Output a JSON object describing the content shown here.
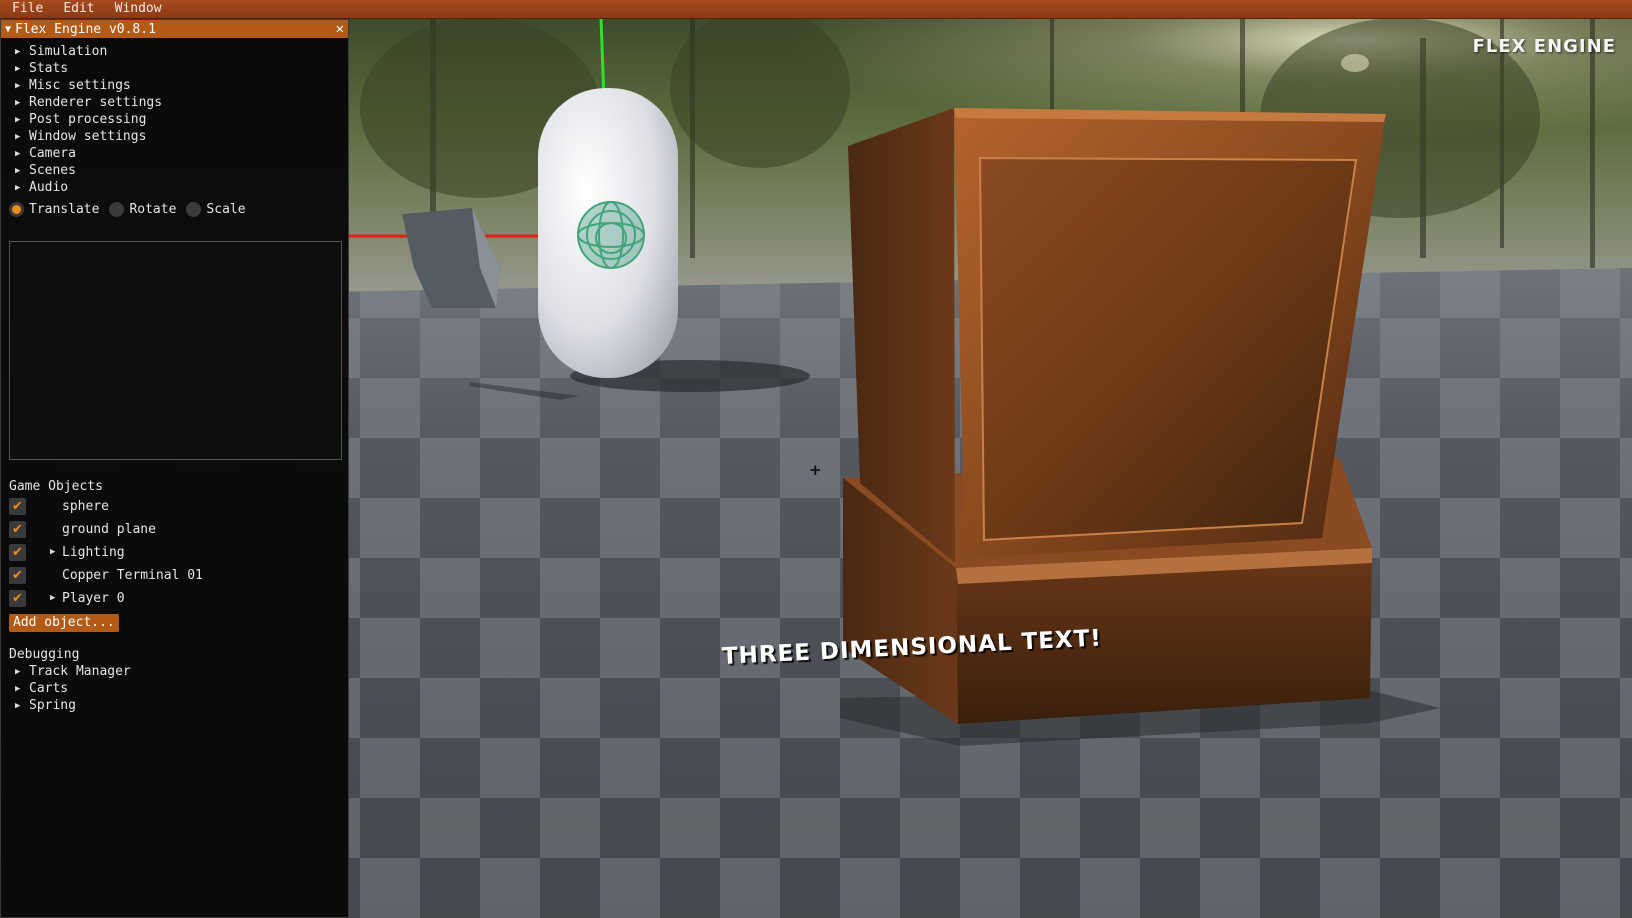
{
  "menubar": {
    "items": [
      "File",
      "Edit",
      "Window"
    ]
  },
  "panel": {
    "title": "Flex Engine v0.8.1",
    "close_label": "✕",
    "tree_items": [
      "Simulation",
      "Stats",
      "Misc settings",
      "Renderer settings",
      "Post processing",
      "Window settings",
      "Camera",
      "Scenes",
      "Audio"
    ],
    "transform_modes": [
      {
        "label": "Translate",
        "selected": true
      },
      {
        "label": "Rotate",
        "selected": false
      },
      {
        "label": "Scale",
        "selected": false
      }
    ],
    "game_objects_label": "Game Objects",
    "game_objects": [
      {
        "name": "sphere",
        "checked": true,
        "expandable": false
      },
      {
        "name": "ground plane",
        "checked": true,
        "expandable": false
      },
      {
        "name": "Lighting",
        "checked": true,
        "expandable": true
      },
      {
        "name": "Copper Terminal 01",
        "checked": true,
        "expandable": false
      },
      {
        "name": "Player 0",
        "checked": true,
        "expandable": true
      }
    ],
    "add_object_label": "Add object...",
    "debugging_label": "Debugging",
    "debug_items": [
      "Track Manager",
      "Carts",
      "Spring"
    ]
  },
  "viewport": {
    "engine_logo": "FLEX ENGINE",
    "text_3d": "THREE DIMENSIONAL TEXT!",
    "crosshair": "+"
  },
  "colors": {
    "accent": "#b35a17",
    "checkmark": "#f08a18",
    "gizmo_x": "#e0201a",
    "gizmo_y": "#2ee02a",
    "copper": "#8a4a22"
  }
}
